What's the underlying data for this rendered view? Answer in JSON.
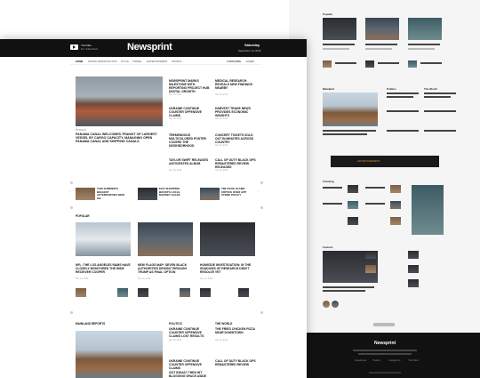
{
  "header": {
    "social_title": "YouTube",
    "social_subtitle": "1K+ Subscribers",
    "logo": "Newsprint",
    "day": "Saturday",
    "date": "September 14, 2019"
  },
  "nav": {
    "items": [
      "Home",
      "World News",
      "Politics",
      "Style",
      "Travel",
      "Entertainment",
      "Sports"
    ],
    "right": [
      "Subscribe",
      "Login"
    ]
  },
  "hero": {
    "category": "Business",
    "title": "Panama Canal Welcomes Transit of Largest Vessel by Cargo Capacity, Managing Open Panama Canal and Shipping Canals"
  },
  "side_stories": [
    {
      "title": "Newsprint Marks Milestone with Reporting Project Hub Digital Growth",
      "date": "Nov 18, 2019"
    },
    {
      "title": "Medical Research Reveals New Findings Nearby",
      "date": "Nov 18, 2019"
    },
    {
      "title": "Ukraine Continue Counter Offensive Claims",
      "date": "Nov 18, 2019"
    },
    {
      "title": "Harvest Trade News Provides Economic Insights",
      "date": "Nov 18, 2019"
    },
    {
      "title": "Tremendous Multicolored Poster Covers the Neighborhood",
      "date": "Nov 18, 2019"
    },
    {
      "title": "Concert Tickets Sold Out in Minutes Across Country",
      "date": "Nov 18, 2019"
    },
    {
      "title": "Taylor Swift Releases Anticipated Album",
      "date": "Nov 18, 2019"
    },
    {
      "title": "Call of Duty Black Ops Remastered Review Released",
      "date": "Nov 18, 2019"
    }
  ],
  "strip": [
    {
      "title": "This Summer's Biggest Afterparties Now on",
      "date": "Nov 18, 2019"
    },
    {
      "title": "Eco Shopping Boosts Local Market Sales",
      "date": "Nov 18, 2019"
    },
    {
      "title": "Tim Cook Slams Critics Over App Store Policy",
      "date": "Nov 18, 2019"
    }
  ],
  "popular": {
    "heading": "Popular",
    "items": [
      {
        "title": "NFL: The Los Angeles Rams Have Closely Monitored the Wide Receiver Cooper",
        "date": "Nov 18, 2019"
      },
      {
        "title": "New Flags Map: Seven Black Authorities Design Through Trump as Final Option",
        "date": "Nov 18, 2019"
      },
      {
        "title": "Homicide Investigation: In the Shadows of Research Didn't Resolve Yet",
        "date": "Nov 18, 2019"
      }
    ]
  },
  "bottom": {
    "sections": [
      "Mainland Reports",
      "Politics",
      "The World"
    ],
    "items": [
      {
        "title": "Ukraine Continue Counter Offensive Claims Lost Results",
        "date": "Nov 18, 2019"
      },
      {
        "title": "The Fried Chicken Pizza Near Downtown",
        "date": "Nov 18, 2019"
      },
      {
        "title": "Ukraine Continue Counter Offensive Claims",
        "date": "Nov 18, 2019"
      },
      {
        "title": "Call of Duty Black Ops Remastered Review",
        "date": "Nov 18, 2019"
      },
      {
        "title": "Got Ideas? Then Hit Blogging Space Aside",
        "date": "Nov 18, 2019"
      }
    ]
  },
  "back_page": {
    "sections": [
      "Popular",
      "Mainland",
      "Politics",
      "The World",
      "Trending",
      "Fashion"
    ],
    "footer_logo": "Newsprint",
    "footer_social": [
      "Facebook",
      "Twitter",
      "Instagram",
      "YouTube"
    ]
  }
}
